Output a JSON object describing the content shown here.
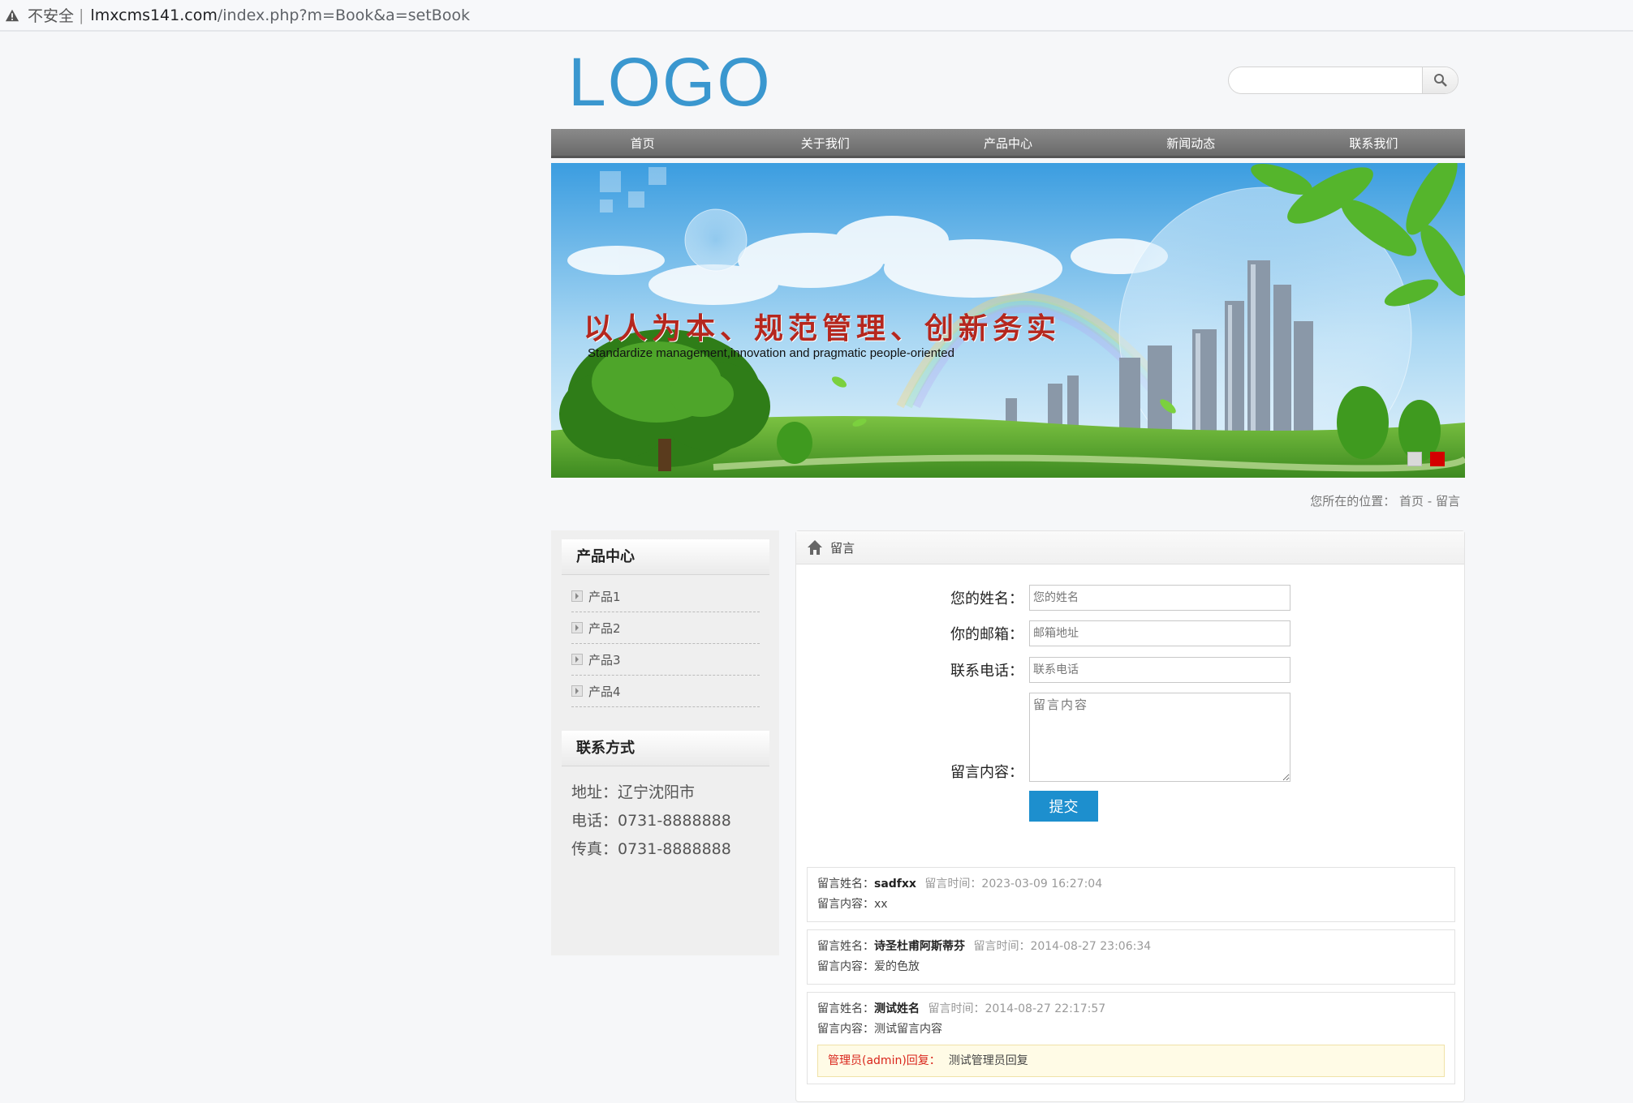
{
  "browser": {
    "insecure_label": "不安全",
    "separator": "|",
    "domain": "lmxcms141.com",
    "path": "/index.php?m=Book&a=setBook"
  },
  "header": {
    "logo": "LOGO",
    "search_placeholder": ""
  },
  "nav": {
    "items": [
      "首页",
      "关于我们",
      "产品中心",
      "新闻动态",
      "联系我们"
    ]
  },
  "banner": {
    "slogan": "以人为本、规范管理、创新务实",
    "subslogan": "Standardize management,innovation and pragmatic people-oriented"
  },
  "breadcrumb": {
    "prefix": "您所在的位置：",
    "home": "首页",
    "sep": "-",
    "current": "留言"
  },
  "sidebar": {
    "products_title": "产品中心",
    "products": [
      "产品1",
      "产品2",
      "产品3",
      "产品4"
    ],
    "contact_title": "联系方式",
    "address": "地址：辽宁沈阳市",
    "phone": "电话：0731-8888888",
    "fax": "传真：0731-8888888"
  },
  "main": {
    "title": "留言",
    "form": {
      "name_label": "您的姓名：",
      "name_placeholder": "您的姓名",
      "email_label": "你的邮箱：",
      "email_placeholder": "邮箱地址",
      "phone_label": "联系电话：",
      "phone_placeholder": "联系电话",
      "content_label": "留言内容：",
      "content_placeholder": "留言内容",
      "submit": "提交"
    },
    "messages": [
      {
        "name_label": "留言姓名：",
        "name": "sadfxx",
        "time_label": "留言时间：",
        "time": "2023-03-09 16:27:04",
        "content_label": "留言内容：",
        "content": "xx"
      },
      {
        "name_label": "留言姓名：",
        "name": "诗圣杜甫阿斯蒂芬",
        "time_label": "留言时间：",
        "time": "2014-08-27 23:06:34",
        "content_label": "留言内容：",
        "content": "爱的色放"
      },
      {
        "name_label": "留言姓名：",
        "name": "测试姓名",
        "time_label": "留言时间：",
        "time": "2014-08-27 22:17:57",
        "content_label": "留言内容：",
        "content": "测试留言内容",
        "reply_label": "管理员(admin)回复：",
        "reply": "测试管理员回复"
      }
    ]
  },
  "colors": {
    "accent": "#1d8fce",
    "logo": "#3a97cf",
    "reply_red": "#d9261c",
    "banner_dot_active": "#d40000"
  }
}
